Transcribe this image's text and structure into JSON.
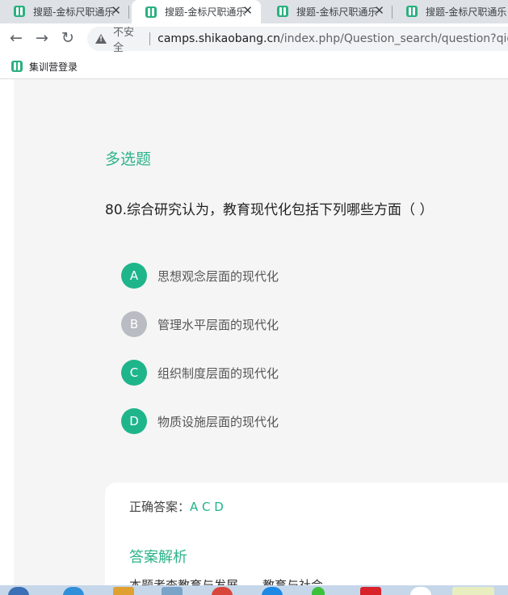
{
  "browser": {
    "tabs": [
      {
        "title": "搜题-金标尺职通乐",
        "active": false
      },
      {
        "title": "搜题-金标尺职通乐",
        "active": true
      },
      {
        "title": "搜题-金标尺职通乐",
        "active": false
      },
      {
        "title": "搜题-金标尺职通乐",
        "active": false
      }
    ],
    "tab_close_glyph": "✕",
    "nav": {
      "back_glyph": "←",
      "forward_glyph": "→",
      "reload_glyph": "↻"
    },
    "security_label": "不安全",
    "url_host": "camps.shikaobang.cn",
    "url_path": "/index.php/Question_search/question?qid=",
    "bookmark_label": "集训营登录"
  },
  "question": {
    "type_label": "多选题",
    "text": "80.综合研究认为，教育现代化包括下列哪些方面（   ）",
    "options": [
      {
        "letter": "A",
        "text": "思想观念层面的现代化",
        "correct": true
      },
      {
        "letter": "B",
        "text": "管理水平层面的现代化",
        "correct": false
      },
      {
        "letter": "C",
        "text": "组织制度层面的现代化",
        "correct": true
      },
      {
        "letter": "D",
        "text": "物质设施层面的现代化",
        "correct": true
      }
    ]
  },
  "answer": {
    "label": "正确答案：",
    "value": "A C D",
    "analysis_title": "答案解析",
    "analysis_text": "本题考查教育与发展——教育与社会"
  },
  "colors": {
    "accent": "#2db38a",
    "correct_badge": "#1fb58b",
    "wrong_badge": "#b9bcc2",
    "page_bg": "#f5f5f5",
    "tab_strip_bg": "#dee1e6"
  },
  "icons": {
    "tab_favicon": "book-icon",
    "security": "warning-triangle-icon"
  }
}
